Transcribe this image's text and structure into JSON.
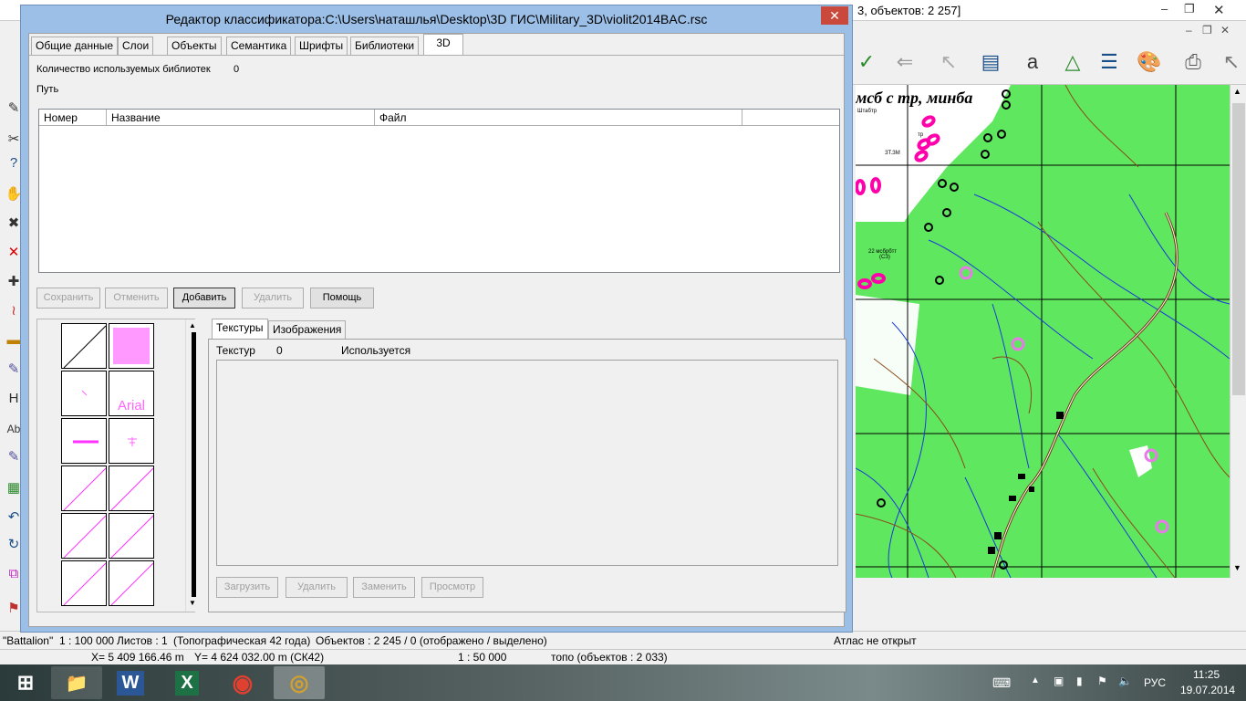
{
  "bg_app": {
    "title_fragment": "3, объектов: 2 257]",
    "status1": {
      "map_name": "\"Battalion\"",
      "scale": "1 : 100 000",
      "sheets": "Листов : 1",
      "type": "(Топографическая 42 года)",
      "objects": "Объектов : 2 245 / 0 (отображено / выделено)",
      "atlas": "Атлас не открыт"
    },
    "status2": {
      "x": "X= 5 409 166.46 m",
      "y": "Y= 4 624 032.00 m  (СК42)",
      "scale": "1 : 50 000",
      "layer": "топо   (объектов : 2 033)"
    },
    "map_label": "мсб с тр, минба",
    "map_small_labels": [
      "Штабтр",
      "тр",
      "ЗТ.ЗМ",
      "22 мсбрбтт",
      "(СЗ)"
    ]
  },
  "taskbar": {
    "lang": "РУС",
    "time": "11:25",
    "date": "19.07.2014"
  },
  "dialog": {
    "title": "Редактор классификатора:C:\\Users\\наташлья\\Desktop\\3D ГИС\\Military_3D\\violit2014BAC.rsc",
    "close": "✕",
    "tabs": [
      "Общие данные",
      "Слои",
      "Объекты",
      "Семантика",
      "Шрифты",
      "Библиотеки",
      "3D"
    ],
    "lib_count_label": "Количество используемых библиотек",
    "lib_count_value": "0",
    "path_label": "Путь",
    "columns": [
      "Номер",
      "Название",
      "Файл"
    ],
    "buttons": {
      "save": "Сохранить",
      "cancel": "Отменить",
      "add": "Добавить",
      "delete": "Удалить",
      "help": "Помощь"
    },
    "preview_font_sample": "Arial",
    "subtabs": [
      "Текстуры",
      "Изображения"
    ],
    "tex_label": "Текстур",
    "tex_count": "0",
    "tex_used": "Используется",
    "tex_buttons": {
      "load": "Загрузить",
      "delete": "Удалить",
      "replace": "Заменить",
      "view": "Просмотр"
    }
  },
  "colors": {
    "map_green": "#5fe85f",
    "symbol_pink": "#ff66ff",
    "dialog_frame": "#9bbfe6"
  }
}
